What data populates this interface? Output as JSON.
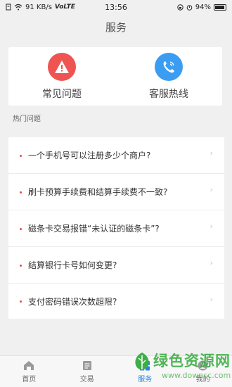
{
  "status_bar": {
    "speed": "91 KB/s",
    "network": "VoLTE",
    "time": "13:56",
    "battery": "94%"
  },
  "header": {
    "title": "服务"
  },
  "services": {
    "faq_label": "常见问题",
    "hotline_label": "客服热线"
  },
  "hot_section": {
    "heading": "热门问题"
  },
  "faq_items": [
    "一个手机号可以注册多少个商户?",
    "刷卡预算手续费和结算手续费不一致?",
    "磁条卡交易报错“未认证的磁条卡”?",
    "结算银行卡号如何变更?",
    "支付密码错误次数超限?"
  ],
  "tabs": {
    "home": "首页",
    "transactions": "交易",
    "service": "服务",
    "mine": "我的"
  },
  "watermark": {
    "title": "绿色资源网",
    "url": "www.downcc.com"
  },
  "colors": {
    "accent_blue": "#2b82e0",
    "red_icon": "#ee5552",
    "blue_icon": "#3a9df2",
    "bullet_red": "#e0504a"
  }
}
